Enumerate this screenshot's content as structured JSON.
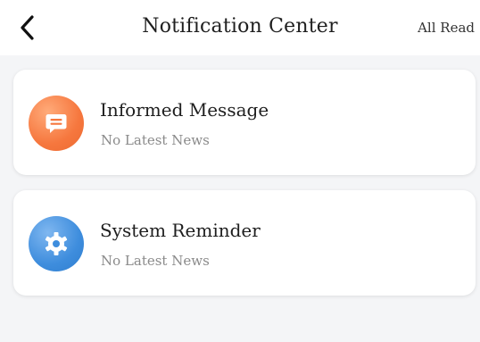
{
  "header": {
    "back_icon": "chevron-left-icon",
    "title": "Notification Center",
    "all_read_label": "All Read"
  },
  "notifications": [
    {
      "title": "Informed Message",
      "subtitle": "No Latest News",
      "icon": "message-icon",
      "icon_color": "#f6773e"
    },
    {
      "title": "System Reminder",
      "subtitle": "No Latest News",
      "icon": "gear-icon",
      "icon_color": "#3e8ddd"
    }
  ]
}
